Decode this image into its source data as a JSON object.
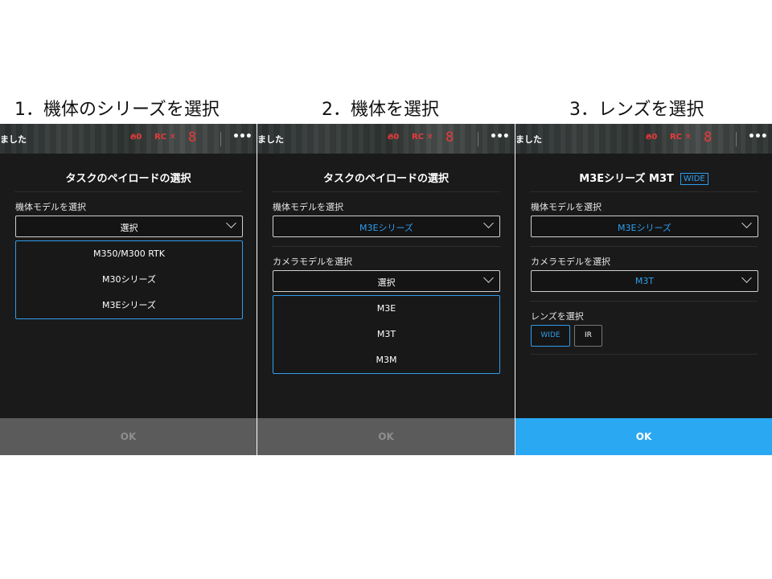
{
  "steps": [
    {
      "title": "1．機体のシリーズを選択"
    },
    {
      "title": "2．機体を選択"
    },
    {
      "title": "3．レンズを選択"
    }
  ],
  "topbar": {
    "status_text": "ました",
    "fire_label": "0",
    "rc_label": "RC ✕",
    "segment_value": "8",
    "more_label": "•••"
  },
  "dialog": {
    "title": "タスクのペイロードの選択",
    "aircraft_model_label": "機体モデルを選択",
    "camera_model_label": "カメラモデルを選択",
    "lens_label": "レンズを選択",
    "ok_label": "OK"
  },
  "panel1": {
    "aircraft_select_value": "選択",
    "aircraft_options": [
      "M350/M300 RTK",
      "M30シリーズ",
      "M3Eシリーズ"
    ]
  },
  "panel2": {
    "aircraft_select_value": "M3Eシリーズ",
    "camera_select_value": "選択",
    "camera_options": [
      "M3E",
      "M3T",
      "M3M"
    ]
  },
  "panel3": {
    "title": "M3Eシリーズ M3T",
    "title_badge": "WIDE",
    "aircraft_select_value": "M3Eシリーズ",
    "camera_select_value": "M3T",
    "lens_options": [
      "WIDE",
      "IR"
    ],
    "selected_lens": "WIDE"
  },
  "colors": {
    "accent": "#2f9dee",
    "ok_active": "#2aa8f2",
    "ok_disabled": "#5b5b5b",
    "status_red": "#e83a3a",
    "panel_bg": "#1a1a1a"
  }
}
